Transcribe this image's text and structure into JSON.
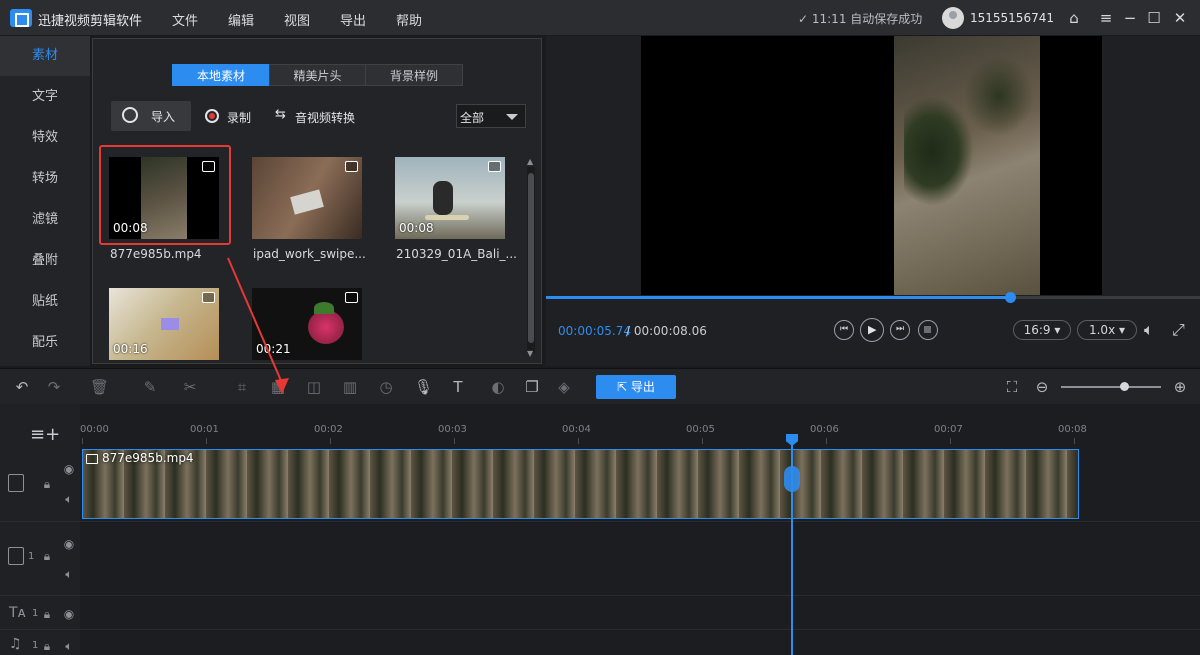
{
  "app": {
    "title": "迅捷视频剪辑软件",
    "menu": [
      "文件",
      "编辑",
      "视图",
      "导出",
      "帮助"
    ],
    "save_status": "✓ 11:11 自动保存成功",
    "user_id": "15155156741"
  },
  "sidebar": {
    "items": [
      {
        "label": "素材",
        "active": true
      },
      {
        "label": "文字"
      },
      {
        "label": "特效"
      },
      {
        "label": "转场"
      },
      {
        "label": "滤镜"
      },
      {
        "label": "叠附"
      },
      {
        "label": "贴纸"
      },
      {
        "label": "配乐"
      }
    ]
  },
  "library": {
    "tabs": [
      "本地素材",
      "精美片头",
      "背景样例"
    ],
    "active_tab": "本地素材",
    "import_label": "导入",
    "record_label": "录制",
    "convert_label": "音视频转换",
    "filter_value": "全部",
    "items": [
      {
        "name": "877e985b.mp4",
        "duration": "00:08",
        "selected": true,
        "kind": "video"
      },
      {
        "name": "ipad_work_swipe...",
        "duration": "",
        "kind": "image"
      },
      {
        "name": "210329_01A_Bali_...",
        "duration": "00:08",
        "kind": "video"
      },
      {
        "name": "",
        "duration": "00:16",
        "kind": "video"
      },
      {
        "name": "",
        "duration": "00:21",
        "kind": "video"
      }
    ]
  },
  "preview": {
    "current_time": "00:00:05.74",
    "total_time": "/ 00:00:08.06",
    "progress": 0.71,
    "aspect_ratio": "16:9",
    "speed": "1.0x"
  },
  "toolbar": {
    "export_label": "导出",
    "zoom_level": 0.62
  },
  "timeline": {
    "ruler_labels": [
      "00:00",
      "00:01",
      "00:02",
      "00:03",
      "00:04",
      "00:05",
      "00:06",
      "00:07",
      "00:08"
    ],
    "clip_name": "877e985b.mp4",
    "track_index_labels": [
      "1",
      "1",
      "1"
    ]
  },
  "colors": {
    "accent": "#2d8cf0",
    "highlight": "#e53935"
  }
}
